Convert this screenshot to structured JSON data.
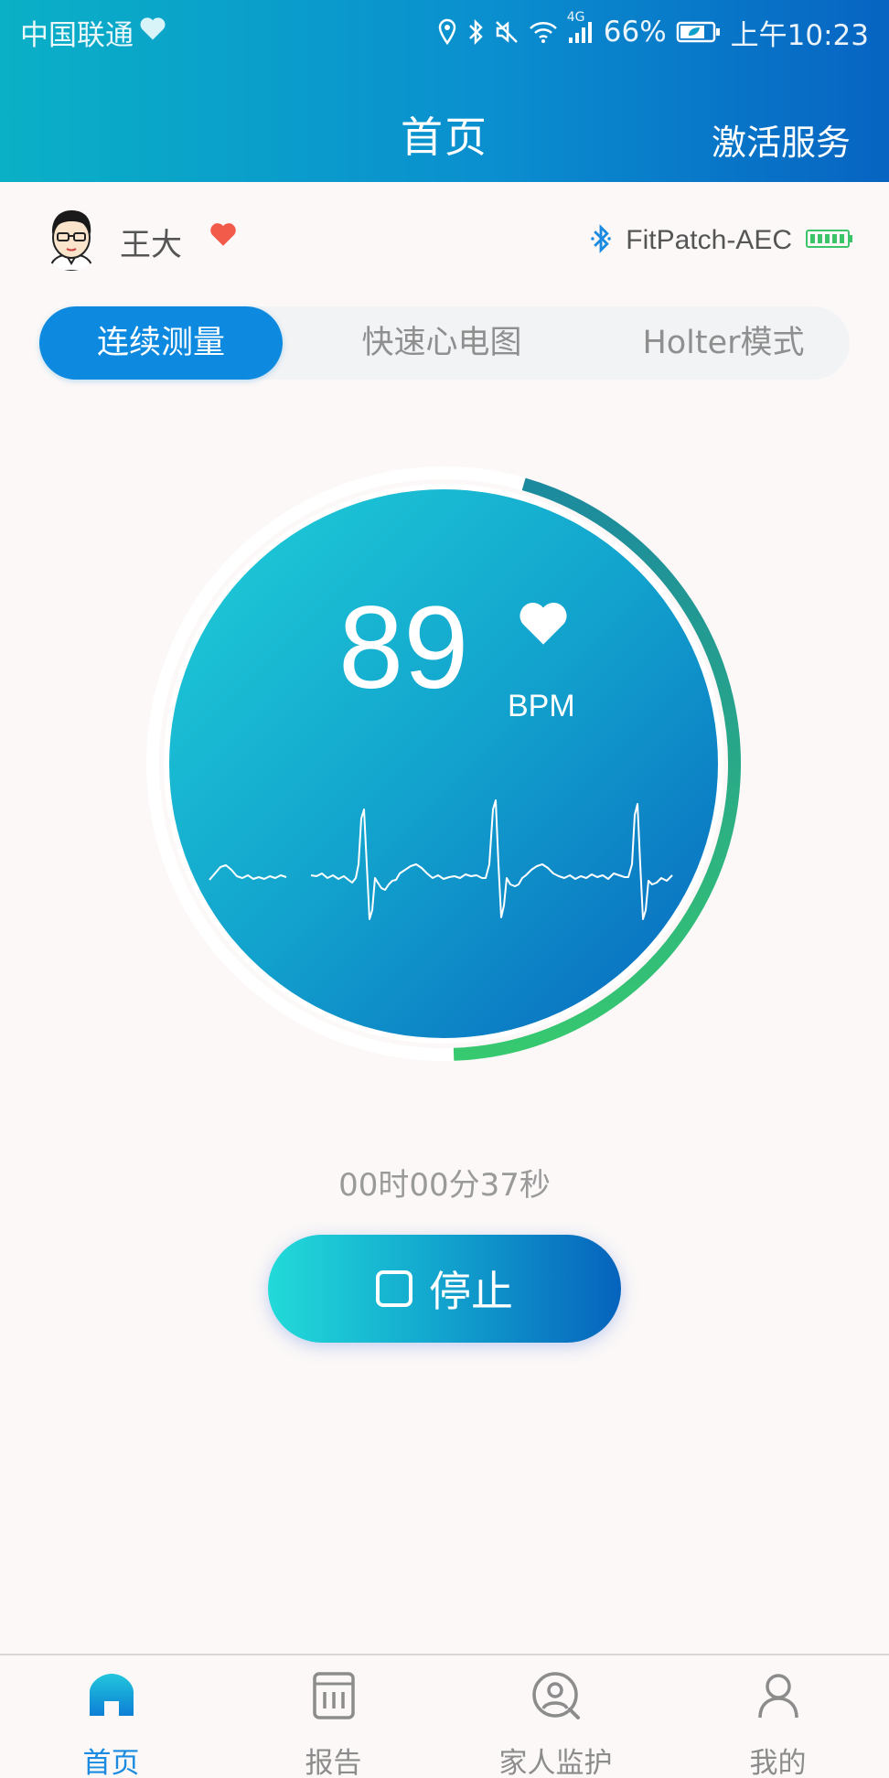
{
  "status_bar": {
    "carrier": "中国联通",
    "network": "4G",
    "battery": "66%",
    "time": "上午10:23"
  },
  "header": {
    "title": "首页",
    "activate_label": "激活服务"
  },
  "user": {
    "name": "王大",
    "device_name": "FitPatch-AEC",
    "device_battery_level": 1.0
  },
  "mode_tabs": [
    {
      "label": "连续测量",
      "active": true
    },
    {
      "label": "快速心电图",
      "active": false
    },
    {
      "label": "Holter模式",
      "active": false
    }
  ],
  "measurement": {
    "bpm": "89",
    "unit": "BPM",
    "progress": 0.45,
    "elapsed": "00时00分37秒"
  },
  "stop_button": {
    "label": "停止"
  },
  "bottom_nav": [
    {
      "label": "首页",
      "icon": "home-icon",
      "active": true
    },
    {
      "label": "报告",
      "icon": "report-icon",
      "active": false
    },
    {
      "label": "家人监护",
      "icon": "family-monitor-icon",
      "active": false
    },
    {
      "label": "我的",
      "icon": "profile-icon",
      "active": false
    }
  ],
  "colors": {
    "accent": "#0d8ae0",
    "heart": "#f25a4a",
    "ring_start": "#1c8a9e",
    "ring_end": "#37c96f"
  }
}
